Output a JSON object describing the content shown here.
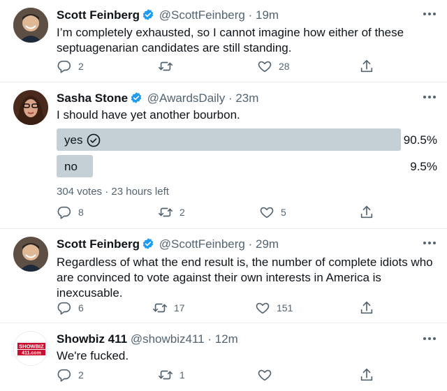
{
  "colors": {
    "accent": "#1d9bf0",
    "muted": "#536471",
    "text": "#0f1419",
    "poll_bar": "#c4cfd6",
    "divider": "#e6ecf0"
  },
  "tweets": [
    {
      "author": "Scott Feinberg",
      "handle": "@ScottFeinberg",
      "sep": "·",
      "time": "19m",
      "verified": true,
      "text": "I’m completely exhausted, so I cannot imagine how either of these septuagenarian candidates are still standing.",
      "replies": "2",
      "retweets": "",
      "likes": "28"
    },
    {
      "author": "Sasha Stone",
      "handle": "@AwardsDaily",
      "sep": "·",
      "time": "23m",
      "verified": true,
      "text": "I should have yet another bourbon.",
      "poll": {
        "options": [
          {
            "label": "yes",
            "percent": "90.5%",
            "value": 0.905,
            "selected": true
          },
          {
            "label": "no",
            "percent": "9.5%",
            "value": 0.095,
            "selected": false
          }
        ],
        "votes": "304 votes",
        "sep": "·",
        "time_left": "23 hours left"
      },
      "replies": "8",
      "retweets": "2",
      "likes": "5"
    },
    {
      "author": "Scott Feinberg",
      "handle": "@ScottFeinberg",
      "sep": "·",
      "time": "29m",
      "verified": true,
      "text": "Regardless of what the end result is, the number of complete idiots who are convinced to vote against their own interests in America is inexcusable.",
      "replies": "6",
      "retweets": "17",
      "likes": "151"
    },
    {
      "author": "Showbiz 411",
      "handle": "@showbiz411",
      "sep": "·",
      "time": "12m",
      "verified": false,
      "avatar_logo_text": [
        "SHOWBIZ",
        "411.com"
      ],
      "text": "We're fucked.",
      "replies": "2",
      "retweets": "1",
      "likes": ""
    }
  ]
}
